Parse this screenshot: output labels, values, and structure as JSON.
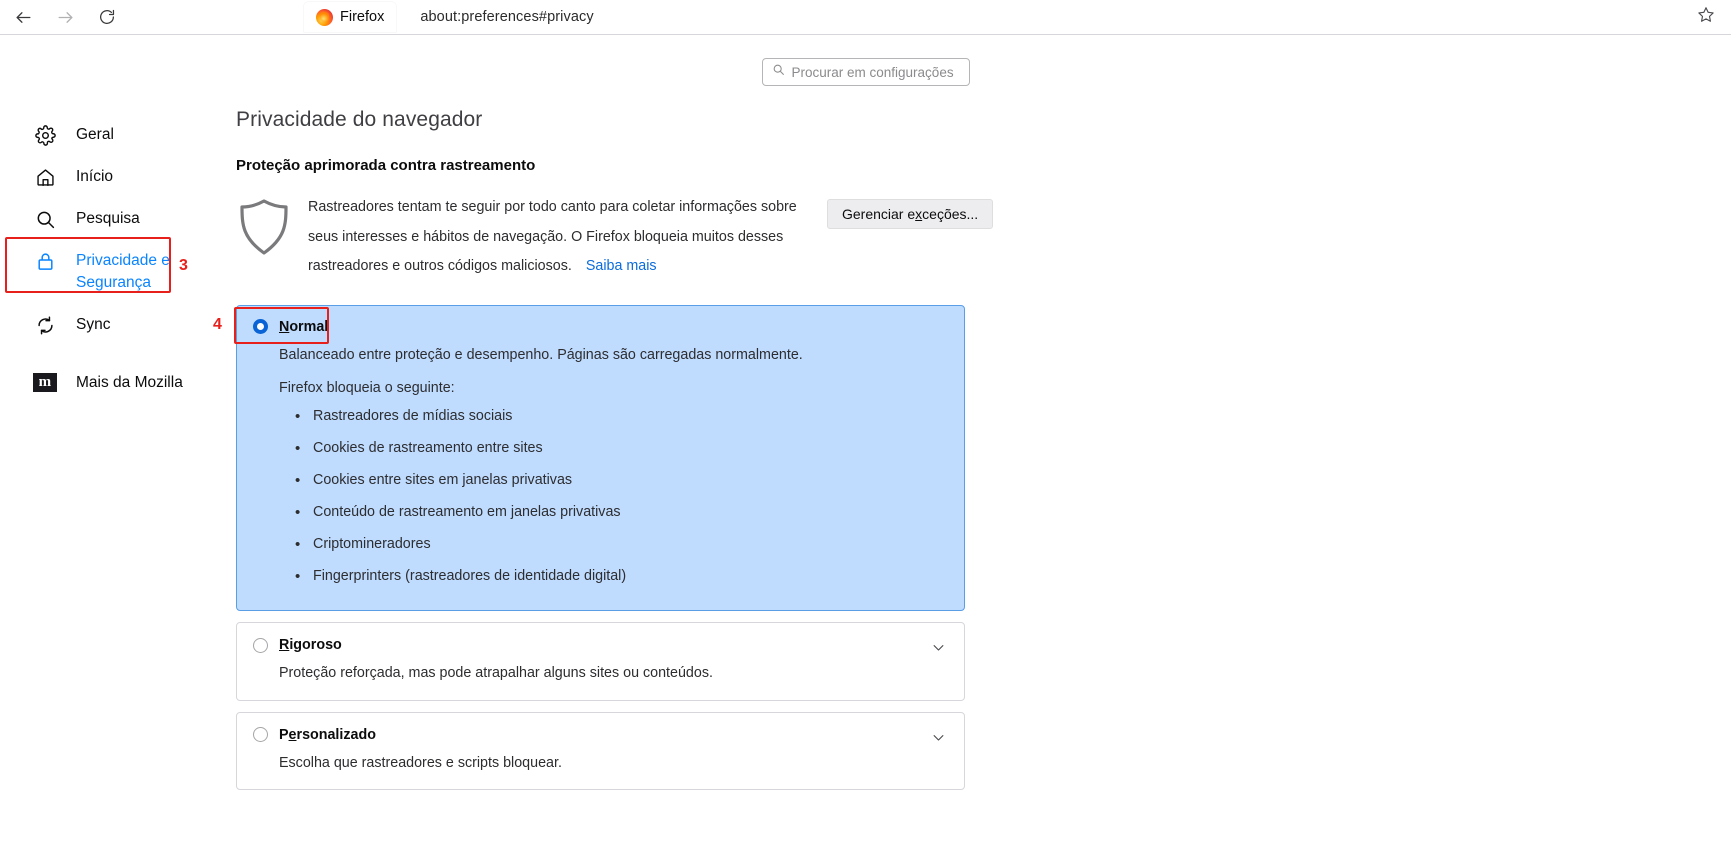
{
  "browser": {
    "back_icon": "arrow-left-icon",
    "forward_icon": "arrow-right-icon",
    "reload_icon": "reload-icon",
    "tab_label": "Firefox",
    "url": "about:preferences#privacy",
    "bookmark_icon": "star-icon"
  },
  "search": {
    "placeholder": "Procurar em configurações",
    "value": "",
    "icon": "search-icon"
  },
  "sidebar": {
    "items": [
      {
        "label": "Geral",
        "icon": "gear-icon",
        "active": false
      },
      {
        "label": "Início",
        "icon": "home-icon",
        "active": false
      },
      {
        "label": "Pesquisa",
        "icon": "search-icon",
        "active": false
      },
      {
        "label": "Privacidade e\nSegurança",
        "icon": "lock-icon",
        "active": true
      },
      {
        "label": "Sync",
        "icon": "sync-icon",
        "active": false
      },
      {
        "label": "Mais da Mozilla",
        "icon": "mozilla-m-icon",
        "active": false
      }
    ]
  },
  "annotations": [
    {
      "number": "3",
      "target": "sidebar-item-privacy-security"
    },
    {
      "number": "4",
      "target": "radio-normal"
    }
  ],
  "main": {
    "page_title": "Privacidade do navegador",
    "section_title": "Proteção aprimorada contra rastreamento",
    "shield_icon": "shield-icon",
    "description": "Rastreadores tentam te seguir por todo canto para coletar informações sobre seus interesses e hábitos de navegação. O Firefox bloqueia muitos desses rastreadores e outros códigos maliciosos.",
    "learn_more": "Saiba mais",
    "exceptions_button": {
      "prefix": "Gerenciar e",
      "accesskey": "x",
      "suffix": "ceções..."
    },
    "options": [
      {
        "id": "normal",
        "title_prefix": "",
        "title_accesskey": "N",
        "title_suffix": "ormal",
        "selected": true,
        "expanded": true,
        "description": "Balanceado entre proteção e desempenho. Páginas são carregadas normalmente.",
        "blocks_label": "Firefox bloqueia o seguinte:",
        "blocks": [
          "Rastreadores de mídias sociais",
          "Cookies de rastreamento entre sites",
          "Cookies entre sites em janelas privativas",
          "Conteúdo de rastreamento em janelas privativas",
          "Criptomineradores",
          "Fingerprinters (rastreadores de identidade digital)"
        ]
      },
      {
        "id": "rigoroso",
        "title_prefix": "",
        "title_accesskey": "R",
        "title_suffix": "igoroso",
        "selected": false,
        "expanded": false,
        "description": "Proteção reforçada, mas pode atrapalhar alguns sites ou conteúdos.",
        "chevron_icon": "chevron-down-icon"
      },
      {
        "id": "personalizado",
        "title_prefix": "P",
        "title_accesskey": "e",
        "title_suffix": "rsonalizado",
        "selected": false,
        "expanded": false,
        "description": "Escolha que rastreadores e scripts bloquear.",
        "chevron_icon": "chevron-down-icon"
      }
    ]
  },
  "colors": {
    "accent_blue": "#0a84ff",
    "link_blue": "#0a6cdc",
    "selected_panel": "#bfdcff",
    "annotation_red": "#e8201c"
  }
}
